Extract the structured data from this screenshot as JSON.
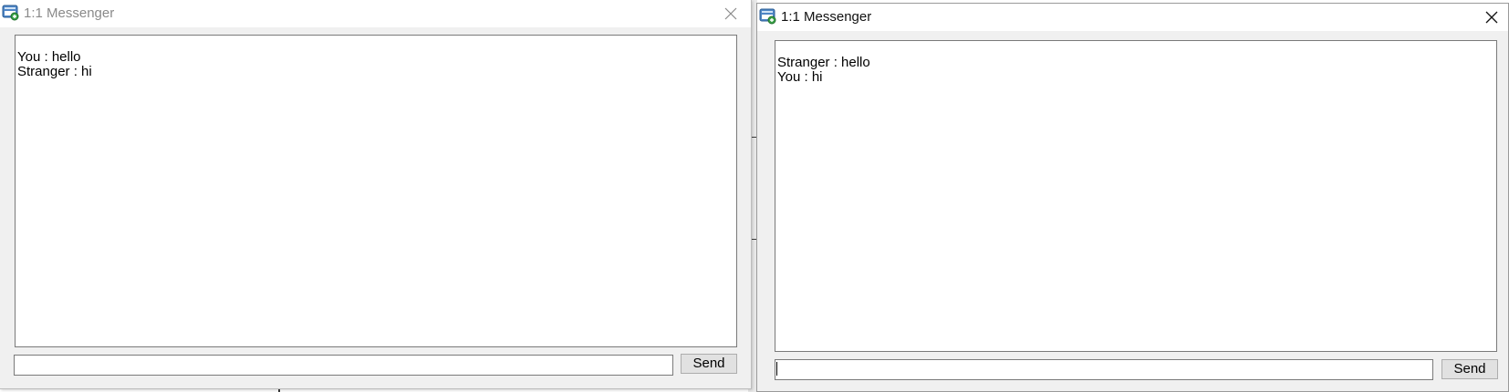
{
  "windows": [
    {
      "title": "1:1 Messenger",
      "active": false,
      "icon": "messenger-app-icon",
      "messages": [
        {
          "text": "You : hello"
        },
        {
          "text": "Stranger : hi"
        }
      ],
      "input": {
        "value": "",
        "placeholder": ""
      },
      "send_label": "Send"
    },
    {
      "title": "1:1 Messenger",
      "active": true,
      "icon": "messenger-app-icon",
      "messages": [
        {
          "text": "Stranger : hello"
        },
        {
          "text": "You : hi"
        }
      ],
      "input": {
        "value": "",
        "placeholder": ""
      },
      "send_label": "Send"
    }
  ]
}
